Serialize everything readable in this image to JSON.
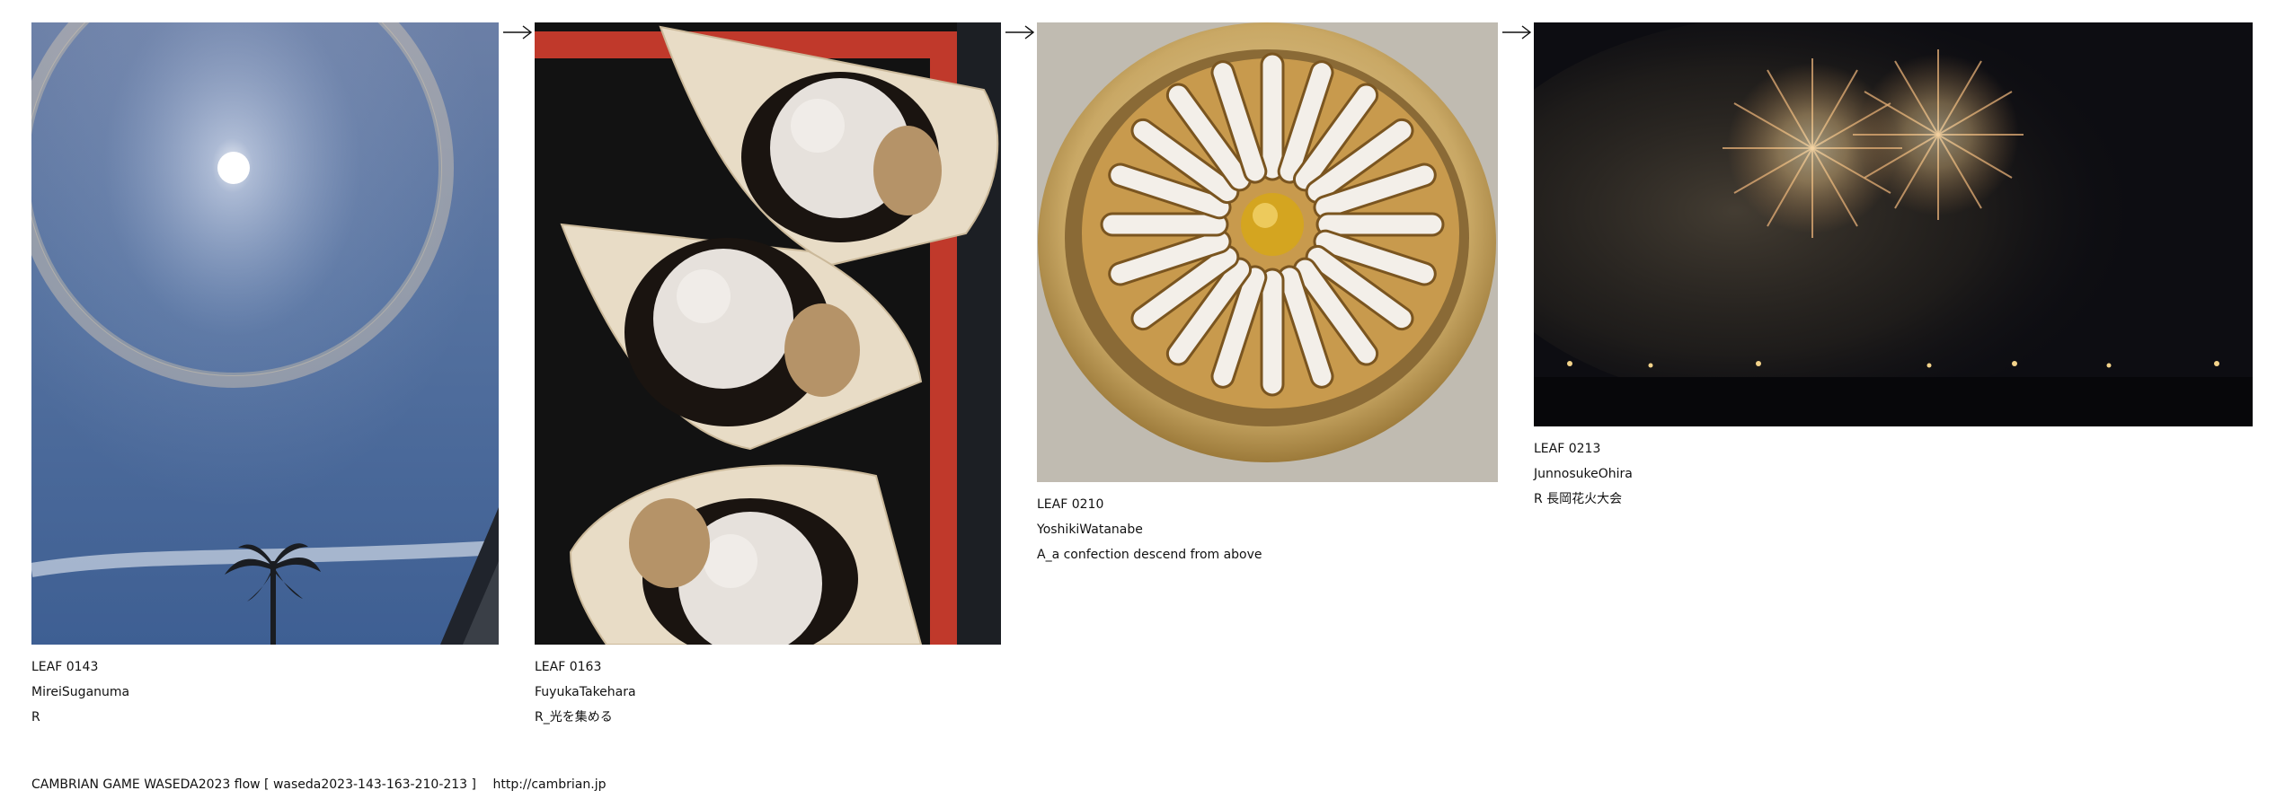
{
  "leaves": [
    {
      "id_label": "LEAF 0143",
      "author": "MireiSuganuma",
      "note": "R",
      "image_description": "sun halo in blue sky with palm tree"
    },
    {
      "id_label": "LEAF 0163",
      "author": "FuyukaTakehara",
      "note": "R_光を集める",
      "image_description": "three white round sweets on wooden leaf plates"
    },
    {
      "id_label": "LEAF 0210",
      "author": "YoshikiWatanabe",
      "note": "A_a confection descend from above",
      "image_description": "radial sugar-dusted pastry with golden center"
    },
    {
      "id_label": "LEAF 0213",
      "author": "JunnosukeOhira",
      "note": "R 長岡花火大会",
      "image_description": "fireworks over dark river night sky"
    }
  ],
  "footer": {
    "title": "CAMBRIAN GAME  WASEDA2023  flow [ waseda2023-143-163-210-213 ]",
    "url": "http://cambrian.jp"
  },
  "icons": {
    "arrow": "right-arrow-icon"
  },
  "colors": {
    "sky": "#5a7ab0",
    "tray": "#121212",
    "tray_rim": "#c0392b",
    "plate_gold": "#b58a3c",
    "night": "#0d0d12"
  }
}
